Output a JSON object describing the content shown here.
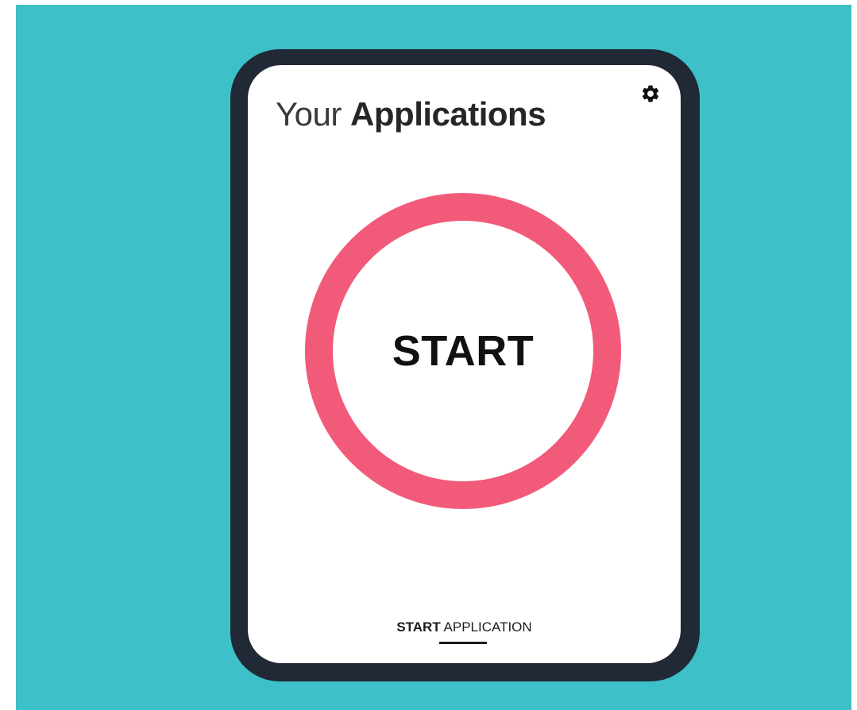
{
  "header": {
    "title_light": "Your",
    "title_bold": "Applications"
  },
  "main": {
    "start_button_label": "START"
  },
  "footer": {
    "tab_bold": "START",
    "tab_regular": "APPLICATION"
  },
  "icons": {
    "settings": "gear-icon"
  },
  "colors": {
    "background": "#3dc0c7",
    "device_frame": "#212836",
    "ring_accent": "#f25a7a"
  }
}
